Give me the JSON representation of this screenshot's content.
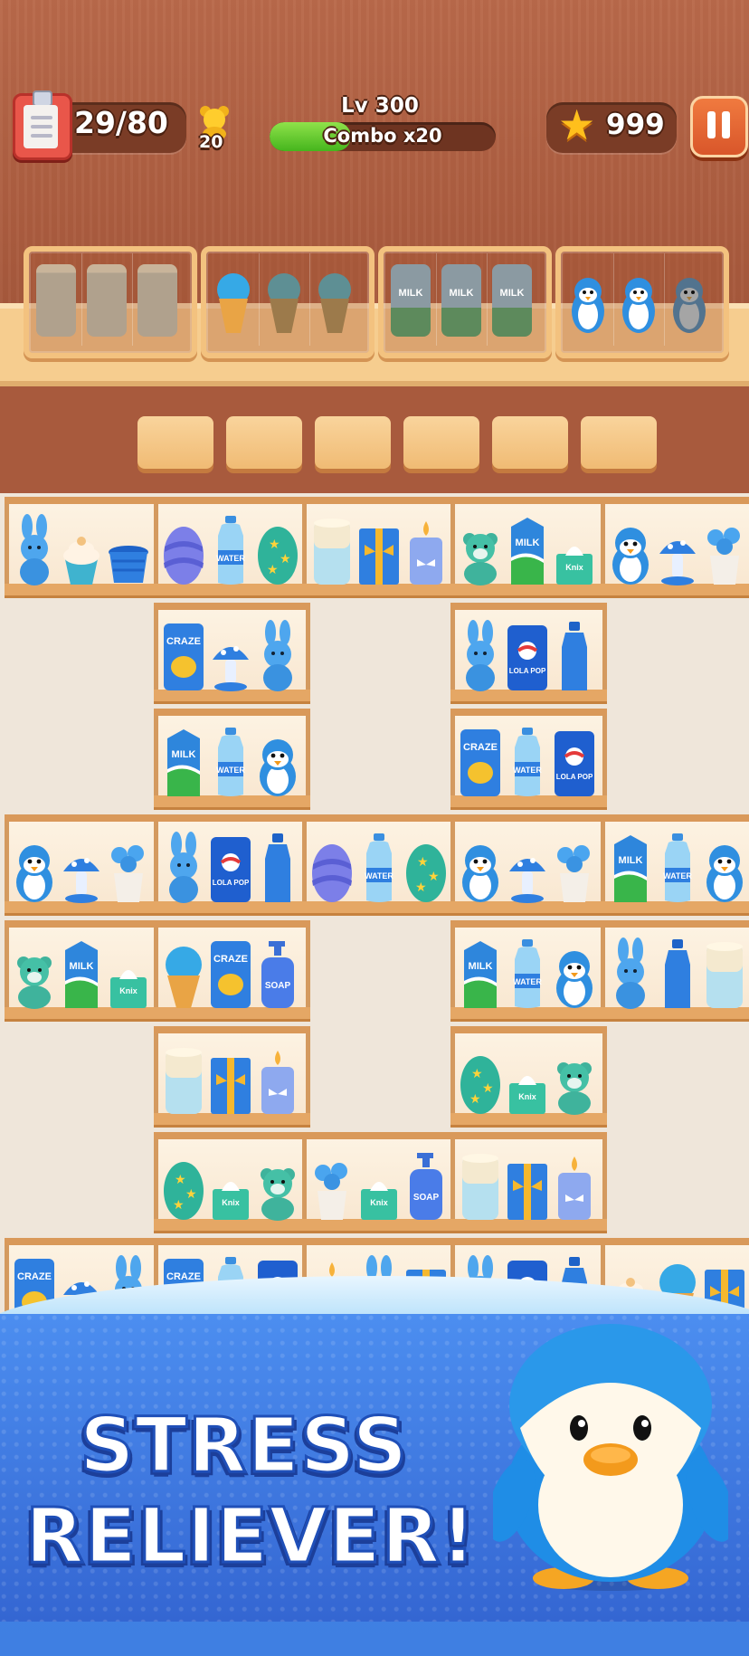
{
  "hud": {
    "task_count": "29/80",
    "bear_count": "20",
    "level": "Lv 300",
    "combo": "Combo x20",
    "combo_progress": 0.36,
    "stars": "999"
  },
  "collected_bins": [
    {
      "item": "toilet-paper",
      "count": 3
    },
    {
      "item": "ice-cream",
      "count": 3
    },
    {
      "item": "milk-carton",
      "count": 3,
      "text": "MILK"
    },
    {
      "item": "penguin",
      "count": 3
    }
  ],
  "pending_slots": 6,
  "labels": {
    "water": "WATER",
    "milk": "MILK",
    "craze": "CRAZE",
    "lola": "LOLA POP",
    "soap": "SOAP",
    "knix": "Knix"
  },
  "banner": {
    "line1": "STRESS",
    "line2": "RELIEVER!"
  },
  "colors": {
    "wood": "#a85a3d",
    "shelf": "#f6cd8f",
    "board": "#efe6da",
    "banner_blue": "#3f7fe2"
  }
}
